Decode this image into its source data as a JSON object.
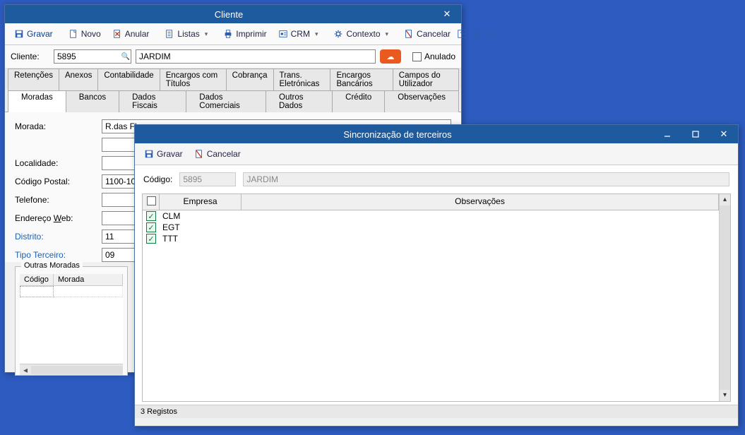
{
  "cliente_window": {
    "title": "Cliente",
    "toolbar": {
      "gravar": "Gravar",
      "novo": "Novo",
      "anular": "Anular",
      "listas": "Listas",
      "imprimir": "Imprimir",
      "crm": "CRM",
      "contexto": "Contexto",
      "cancelar": "Cancelar"
    },
    "cliente_label": "Cliente:",
    "cliente_code": "5895",
    "cliente_name": "JARDIM",
    "anulado_label": "Anulado",
    "anulado_checked": false,
    "tabs_top": [
      "Retenções",
      "Anexos",
      "Contabilidade",
      "Encargos com Títulos",
      "Cobrança",
      "Trans. Eletrónicas",
      "Encargos Bancários",
      "Campos do Utilizador"
    ],
    "tabs_bottom": [
      "Moradas",
      "Bancos",
      "Dados Fiscais",
      "Dados Comerciais",
      "Outros Dados",
      "Crédito",
      "Observações"
    ],
    "active_tab": "Moradas",
    "form": {
      "morada_label": "Morada:",
      "morada_value": "R.das Flores",
      "morada2_value": "",
      "localidade_label": "Localidade:",
      "localidade_value": "",
      "codigo_postal_label": "Código Postal:",
      "codigo_postal_value": "1100-100",
      "telefone_label": "Telefone:",
      "telefone_value": "",
      "endereco_web_label": "Endereço Web:",
      "endereco_web_value": "",
      "distrito_label": "Distrito:",
      "distrito_value": "11",
      "tipo_terceiro_label": "Tipo Terceiro:",
      "tipo_terceiro_value": "09"
    },
    "outras_moradas": {
      "legend": "Outras Moradas",
      "cols": [
        "Código",
        "Morada"
      ],
      "rows": []
    }
  },
  "sync_window": {
    "title": "Sincronização de terceiros",
    "toolbar": {
      "gravar": "Gravar",
      "cancelar": "Cancelar"
    },
    "codigo_label": "Código:",
    "codigo_value": "5895",
    "name_value": "JARDIM",
    "grid_cols": {
      "empresa": "Empresa",
      "observacoes": "Observações"
    },
    "rows": [
      {
        "checked": true,
        "empresa": "CLM",
        "obs": ""
      },
      {
        "checked": true,
        "empresa": "EGT",
        "obs": ""
      },
      {
        "checked": true,
        "empresa": "TTT",
        "obs": ""
      }
    ],
    "status": "3 Registos"
  }
}
